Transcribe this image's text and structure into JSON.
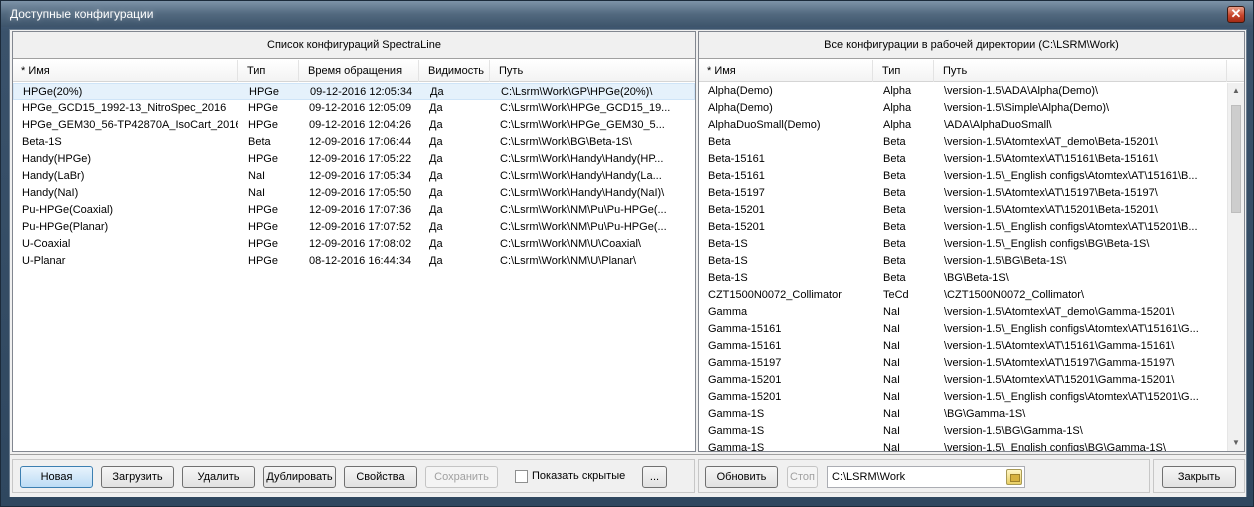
{
  "window": {
    "title": "Доступные конфигурации",
    "close_label": "✕"
  },
  "left_panel": {
    "title": "Список конфигураций SpectraLine",
    "columns": [
      "* Имя",
      "Тип",
      "Время обращения",
      "Видимость",
      "Путь"
    ],
    "rows": [
      [
        "HPGe(20%)",
        "HPGe",
        "09-12-2016 12:05:34",
        "Да",
        "C:\\Lsrm\\Work\\GP\\HPGe(20%)\\"
      ],
      [
        "HPGe_GCD15_1992-13_NitroSpec_2016",
        "HPGe",
        "09-12-2016 12:05:09",
        "Да",
        "C:\\Lsrm\\Work\\HPGe_GCD15_19..."
      ],
      [
        "HPGe_GEM30_56-TP42870A_IsoCart_2016",
        "HPGe",
        "09-12-2016 12:04:26",
        "Да",
        "C:\\Lsrm\\Work\\HPGe_GEM30_5..."
      ],
      [
        "Beta-1S",
        "Beta",
        "12-09-2016 17:06:44",
        "Да",
        "C:\\Lsrm\\Work\\BG\\Beta-1S\\"
      ],
      [
        "Handy(HPGe)",
        "HPGe",
        "12-09-2016 17:05:22",
        "Да",
        "C:\\Lsrm\\Work\\Handy\\Handy(HP..."
      ],
      [
        "Handy(LaBr)",
        "NaI",
        "12-09-2016 17:05:34",
        "Да",
        "C:\\Lsrm\\Work\\Handy\\Handy(La..."
      ],
      [
        "Handy(NaI)",
        "NaI",
        "12-09-2016 17:05:50",
        "Да",
        "C:\\Lsrm\\Work\\Handy\\Handy(NaI)\\"
      ],
      [
        "Pu-HPGe(Coaxial)",
        "HPGe",
        "12-09-2016 17:07:36",
        "Да",
        "C:\\Lsrm\\Work\\NM\\Pu\\Pu-HPGe(..."
      ],
      [
        "Pu-HPGe(Planar)",
        "HPGe",
        "12-09-2016 17:07:52",
        "Да",
        "C:\\Lsrm\\Work\\NM\\Pu\\Pu-HPGe(..."
      ],
      [
        "U-Coaxial",
        "HPGe",
        "12-09-2016 17:08:02",
        "Да",
        "C:\\Lsrm\\Work\\NM\\U\\Coaxial\\"
      ],
      [
        "U-Planar",
        "HPGe",
        "08-12-2016 16:44:34",
        "Да",
        "C:\\Lsrm\\Work\\NM\\U\\Planar\\"
      ]
    ]
  },
  "right_panel": {
    "title": "Все конфигурации в рабочей директории (C:\\LSRM\\Work)",
    "columns": [
      "* Имя",
      "Тип",
      "Путь"
    ],
    "rows": [
      [
        "Alpha(Demo)",
        "Alpha",
        "\\version-1.5\\ADA\\Alpha(Demo)\\"
      ],
      [
        "Alpha(Demo)",
        "Alpha",
        "\\version-1.5\\Simple\\Alpha(Demo)\\"
      ],
      [
        "AlphaDuoSmall(Demo)",
        "Alpha",
        "\\ADA\\AlphaDuoSmall\\"
      ],
      [
        "Beta",
        "Beta",
        "\\version-1.5\\Atomtex\\AT_demo\\Beta-15201\\"
      ],
      [
        "Beta-15161",
        "Beta",
        "\\version-1.5\\Atomtex\\AT\\15161\\Beta-15161\\"
      ],
      [
        "Beta-15161",
        "Beta",
        "\\version-1.5\\_English configs\\Atomtex\\AT\\15161\\B..."
      ],
      [
        "Beta-15197",
        "Beta",
        "\\version-1.5\\Atomtex\\AT\\15197\\Beta-15197\\"
      ],
      [
        "Beta-15201",
        "Beta",
        "\\version-1.5\\Atomtex\\AT\\15201\\Beta-15201\\"
      ],
      [
        "Beta-15201",
        "Beta",
        "\\version-1.5\\_English configs\\Atomtex\\AT\\15201\\B..."
      ],
      [
        "Beta-1S",
        "Beta",
        "\\version-1.5\\_English configs\\BG\\Beta-1S\\"
      ],
      [
        "Beta-1S",
        "Beta",
        "\\version-1.5\\BG\\Beta-1S\\"
      ],
      [
        "Beta-1S",
        "Beta",
        "\\BG\\Beta-1S\\"
      ],
      [
        "CZT1500N0072_Collimator",
        "TeCd",
        "\\CZT1500N0072_Collimator\\"
      ],
      [
        "Gamma",
        "NaI",
        "\\version-1.5\\Atomtex\\AT_demo\\Gamma-15201\\"
      ],
      [
        "Gamma-15161",
        "NaI",
        "\\version-1.5\\_English configs\\Atomtex\\AT\\15161\\G..."
      ],
      [
        "Gamma-15161",
        "NaI",
        "\\version-1.5\\Atomtex\\AT\\15161\\Gamma-15161\\"
      ],
      [
        "Gamma-15197",
        "NaI",
        "\\version-1.5\\Atomtex\\AT\\15197\\Gamma-15197\\"
      ],
      [
        "Gamma-15201",
        "NaI",
        "\\version-1.5\\Atomtex\\AT\\15201\\Gamma-15201\\"
      ],
      [
        "Gamma-15201",
        "NaI",
        "\\version-1.5\\_English configs\\Atomtex\\AT\\15201\\G..."
      ],
      [
        "Gamma-1S",
        "NaI",
        "\\BG\\Gamma-1S\\"
      ],
      [
        "Gamma-1S",
        "NaI",
        "\\version-1.5\\BG\\Gamma-1S\\"
      ],
      [
        "Gamma-1S",
        "NaI",
        "\\version-1.5\\_English configs\\BG\\Gamma-1S\\"
      ]
    ]
  },
  "buttons": {
    "new": "Новая",
    "load": "Загрузить",
    "delete": "Удалить",
    "duplicate": "Дублировать",
    "properties": "Свойства",
    "save": "Сохранить",
    "show_hidden": "Показать скрытые",
    "more": "...",
    "refresh": "Обновить",
    "stop": "Стоп",
    "close": "Закрыть"
  },
  "work_path": "C:\\LSRM\\Work",
  "scrollbar": {
    "up_arrow": "▲",
    "down_arrow": "▼"
  },
  "colors": {
    "selection": "#e5f1fb",
    "primary_button": "#bcdcf5",
    "title_bar": "#52697f"
  }
}
